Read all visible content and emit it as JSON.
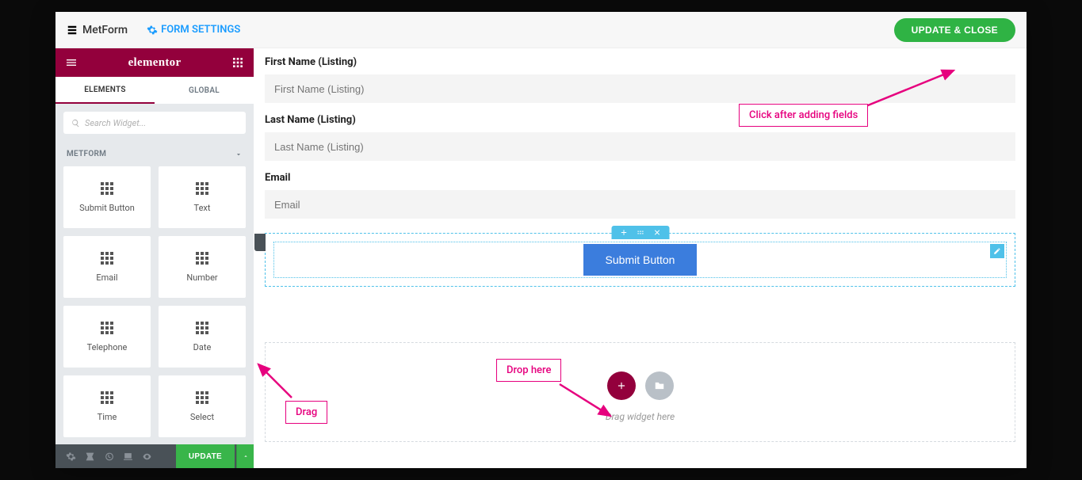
{
  "topBar": {
    "appName": "MetForm",
    "formSettings": "FORM SETTINGS",
    "updateClose": "UPDATE & CLOSE"
  },
  "sidebar": {
    "brand": "elementor",
    "tabs": {
      "elements": "ELEMENTS",
      "global": "GLOBAL"
    },
    "searchPlaceholder": "Search Widget...",
    "accordion": "METFORM",
    "widgets": [
      "Submit Button",
      "Text",
      "Email",
      "Number",
      "Telephone",
      "Date",
      "Time",
      "Select"
    ],
    "footer": {
      "update": "UPDATE"
    }
  },
  "canvas": {
    "fields": [
      {
        "label": "First Name (Listing)",
        "placeholder": "First Name (Listing)"
      },
      {
        "label": "Last Name (Listing)",
        "placeholder": "Last Name (Listing)"
      },
      {
        "label": "Email",
        "placeholder": "Email"
      }
    ],
    "submitLabel": "Submit Button",
    "dropText": "Drag widget here"
  },
  "annotations": {
    "clickAfter": "Click after adding fields",
    "drag": "Drag",
    "dropHere": "Drop here"
  }
}
